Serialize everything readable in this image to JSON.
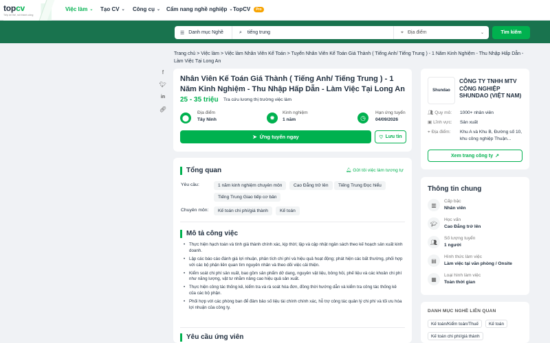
{
  "nav": {
    "logo_main_a": "top",
    "logo_main_b": "cv",
    "logo_tagline": "Tiếp lợi thế, nối thành công",
    "items": [
      "Việc làm",
      "Tạo CV",
      "Công cụ",
      "Cẩm nang nghề nghiệp",
      "TopCV"
    ],
    "pro_badge": "Pro"
  },
  "search": {
    "category": "Danh mục Nghề",
    "query": "tiếng trung",
    "location": "Địa điểm",
    "button": "Tìm kiếm"
  },
  "breadcrumb": {
    "items": [
      "Trang chủ",
      "Việc làm",
      "Việc làm Nhân Viên Kế Toán"
    ],
    "current": "Tuyển Nhân Viên Kế Toán Giá Thành ( Tiếng Anh/ Tiếng Trung ) - 1 Năm Kinh Nghiệm - Thu Nhập Hấp Dẫn - Làm Việc Tại Long An",
    "sep": ">"
  },
  "job": {
    "title": "Nhân Viên Kế Toán Giá Thành ( Tiếng Anh/ Tiếng Trung ) - 1 Năm Kinh Nghiệm - Thu Nhập Hấp Dẫn - Làm Việc Tại Long An",
    "salary": "25 - 35 triệu",
    "salary_link": "Tra cứu lương thị trường việc làm",
    "location_label": "Địa điểm",
    "location": "Tây Ninh",
    "experience_label": "Kinh nghiệm",
    "experience": "1 năm",
    "deadline_label": "Hạn ứng tuyển",
    "deadline": "04/09/2026",
    "apply": "Ứng tuyển ngay",
    "save": "Lưu tin"
  },
  "overview": {
    "title": "Tổng quan",
    "alert": "Gửi tôi việc làm tương tự",
    "req_label": "Yêu cầu:",
    "req_tags": [
      "1 năm kinh nghiệm chuyên môn",
      "Cao Đẳng trở lên",
      "Tiếng Trung Đọc hiểu",
      "Tiếng Trung Giao tiếp cơ bản"
    ],
    "spec_label": "Chuyên môn:",
    "spec_tags": [
      "Kế toán chi phí/giá thành",
      "Kế toán"
    ]
  },
  "description": {
    "title": "Mô tả công việc",
    "bullets": [
      "Thực hiện hạch toán và tính giá thành chính xác, kịp thời; lập và cập nhật ngân sách theo kế hoạch sản xuất kinh doanh.",
      "Lập các báo cáo đánh giá lợi nhuận, phân tích chi phí và hiệu quả hoạt động; phát hiện các bất thường, phối hợp với các bộ phận liên quan tìm nguyên nhân và theo dõi việc cải thiện.",
      "Kiểm soát chi phí sản xuất, bao gồm sản phẩm dở dang, nguyên vật liệu, bông hỏi, phế liệu và các khoản chi phí như năng lượng, vật tư nhằm nâng cao hiệu quả sản xuất.",
      "Thực hiện công tác thống kê, kiểm tra và rà soát hóa đơn, đồng thời hướng dẫn và kiểm tra công tác thống kê của các bộ phận.",
      "Phối hợp với các phòng ban để đảm bảo số liệu tài chính chính xác, hỗ trợ công tác quản lý chi phí và tối ưu hóa lợi nhuận của công ty."
    ],
    "next_title": "Yêu cầu ứng viên"
  },
  "company": {
    "logo_text": "Shundao",
    "name": "CÔNG TY TNHH MTV CÔNG NGHIỆP SHUNDAO (VIỆT NAM)",
    "size_label": "Quy mô:",
    "size": "1000+ nhân viên",
    "field_label": "Lĩnh vực:",
    "field": "Sản xuất",
    "address_label": "Địa điểm:",
    "address": "Khu A và Khu B, Đường số 10, khu công nghiệp Thuận...",
    "view_button": "Xem trang công ty"
  },
  "general": {
    "title": "Thông tin chung",
    "rows": [
      {
        "label": "Cấp bậc",
        "value": "Nhân viên"
      },
      {
        "label": "Học vấn",
        "value": "Cao Đẳng trở lên"
      },
      {
        "label": "Số lượng tuyển",
        "value": "1 người"
      },
      {
        "label": "Hình thức làm việc",
        "value": "Làm việc tại văn phòng / Onsite"
      },
      {
        "label": "Loại hình làm việc",
        "value": "Toàn thời gian"
      }
    ]
  },
  "related": {
    "title": "DANH MỤC NGHỀ LIÊN QUAN",
    "tags": [
      "Kế toán/Kiểm toán/Thuế",
      "Kế toán",
      "Kế toán chi phí/giá thành"
    ]
  },
  "colors": {
    "brand": "#00b14f",
    "search_bg": "#19734e"
  }
}
